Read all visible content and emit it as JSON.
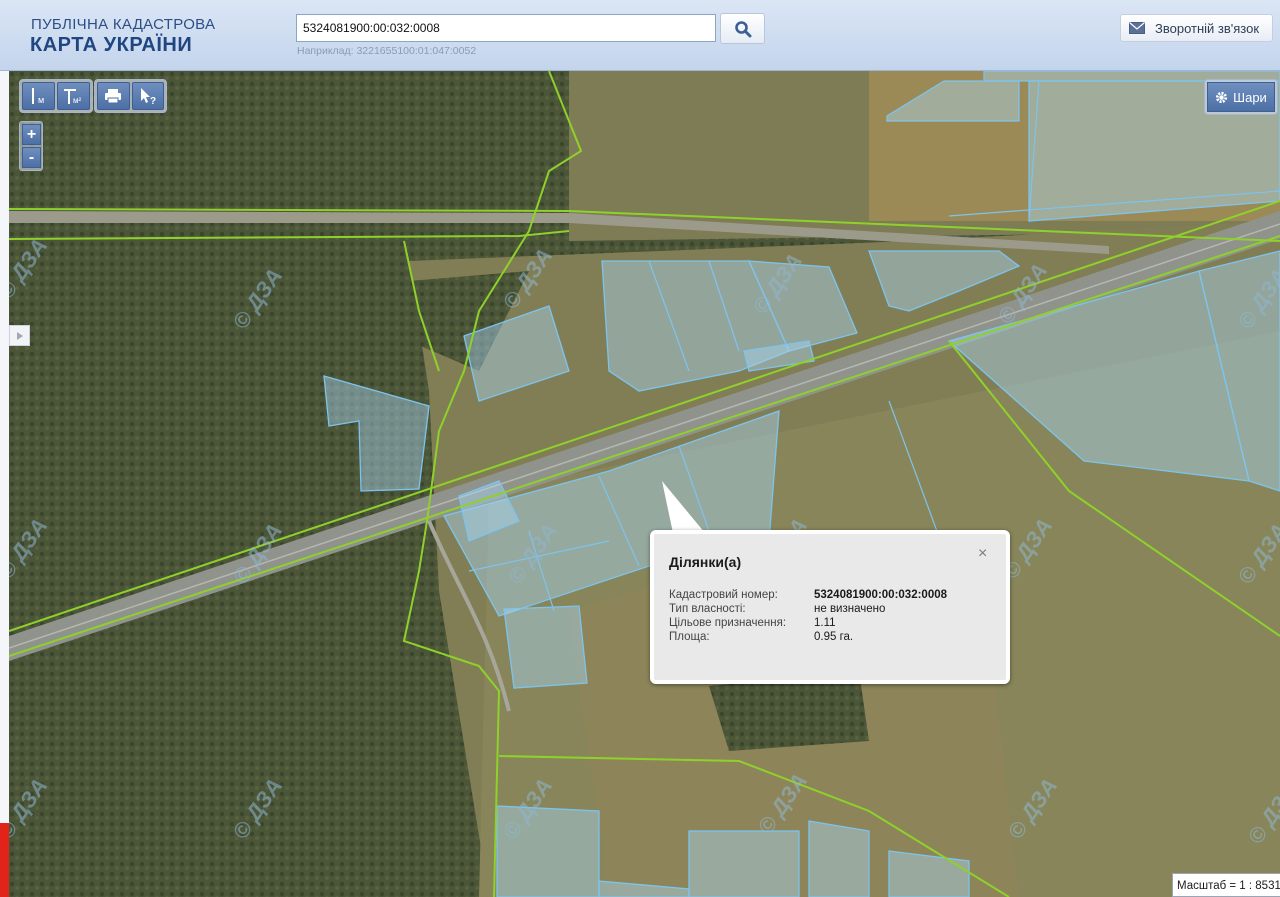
{
  "header": {
    "logo_line1": "ПУБЛІЧНА КАДАСТРОВА",
    "logo_line2": "КАРТА УКРАЇНИ",
    "search_value": "5324081900:00:032:0008",
    "search_hint": "Наприклад: 3221655100:01:047:0052",
    "search_icon": "magnifier-icon",
    "feedback_label": "Зворотній зв'язок",
    "feedback_icon": "envelope-icon"
  },
  "toolbar": {
    "measure_line_icon": "ruler-line-icon",
    "measure_line_unit": "м",
    "measure_area_icon": "ruler-area-icon",
    "measure_area_unit": "м²",
    "print_icon": "printer-icon",
    "identify_icon": "pointer-question-icon",
    "zoom_in": "+",
    "zoom_out": "-",
    "layers_label": "Шари",
    "layers_icon": "gear-icon"
  },
  "popup": {
    "title": "Ділянки(а)",
    "close": "×",
    "rows": [
      {
        "label": "Кадастровий номер:",
        "value": "5324081900:00:032:0008"
      },
      {
        "label": "Тип власності:",
        "value": "не визначено"
      },
      {
        "label": "Цільове призначення:",
        "value": "1.11"
      },
      {
        "label": "Площа:",
        "value": "0.95 га."
      }
    ]
  },
  "watermark": "© ДЗА",
  "scale_label": "Масштаб = 1 : 8531",
  "colors": {
    "parcel_fill": "#a8d4f2",
    "parcel_stroke": "#7cc4ee",
    "boundary_green": "#8fd12b",
    "header_bg": "#c8d8ee",
    "toolbar_blue": "#5a7db3"
  }
}
